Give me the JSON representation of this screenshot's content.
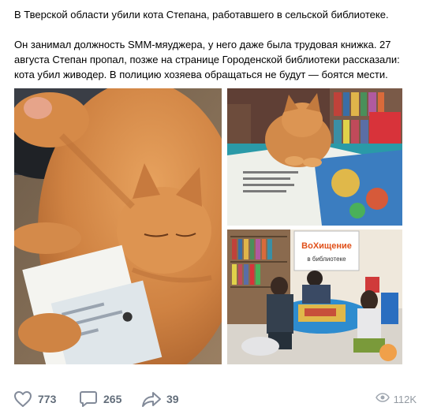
{
  "post": {
    "lines": [
      "В Тверской области убили кота Степана, работавшего в сельской библиотеке.",
      "Он занимал должность SMM-мяуджера, у него даже была трудовая книжка. 27",
      "августа Степан пропал, позже на странице Городенской библиотеки рассказали:",
      "кота убил живодер. В полицию хозяева обращаться не будут — боятся мести."
    ]
  },
  "photos": {
    "sign_line1": "ВоХищение",
    "sign_line2": "в библиотеке"
  },
  "actions": {
    "likes": "773",
    "comments": "265",
    "shares": "39",
    "views": "112K"
  },
  "colors": {
    "accent_grey": "#626d7a",
    "views_grey": "#939aa2"
  }
}
